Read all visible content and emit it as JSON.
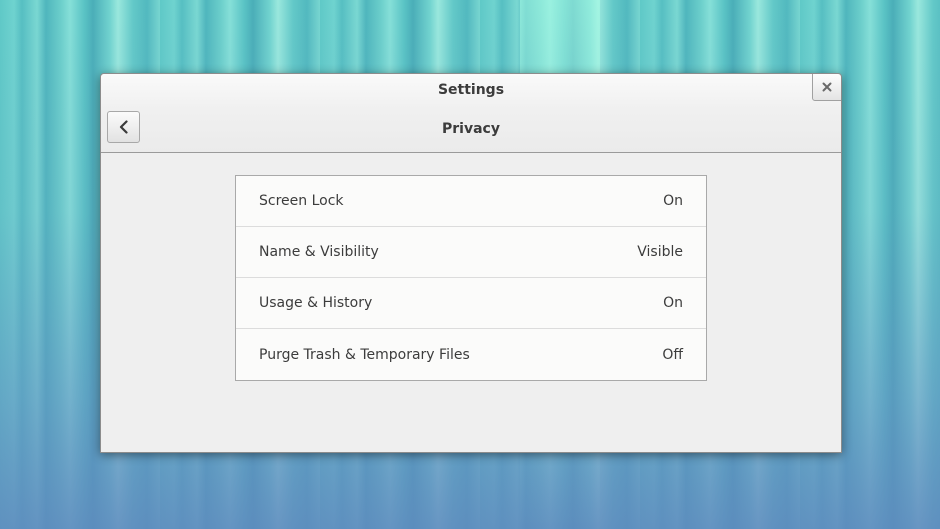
{
  "window": {
    "title": "Settings",
    "page_title": "Privacy"
  },
  "icons": {
    "back": "chevron-left-icon",
    "close": "close-icon"
  },
  "privacy_items": [
    {
      "label": "Screen Lock",
      "value": "On"
    },
    {
      "label": "Name & Visibility",
      "value": "Visible"
    },
    {
      "label": "Usage & History",
      "value": "On"
    },
    {
      "label": "Purge Trash & Temporary Files",
      "value": "Off"
    }
  ],
  "colors": {
    "window_bg": "#efefef",
    "list_bg": "#fbfbfa",
    "text": "#3c3c3c"
  }
}
